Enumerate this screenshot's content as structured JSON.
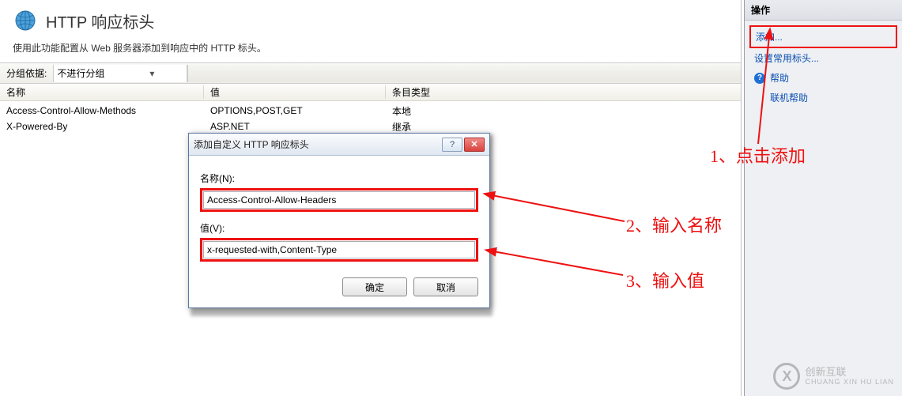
{
  "header": {
    "title": "HTTP 响应标头",
    "subtitle": "使用此功能配置从 Web 服务器添加到响应中的 HTTP 标头。"
  },
  "grouping": {
    "label": "分组依据:",
    "selected": "不进行分组"
  },
  "columns": {
    "name": "名称",
    "value": "值",
    "type": "条目类型"
  },
  "rows": [
    {
      "name": "Access-Control-Allow-Methods",
      "value": "OPTIONS,POST,GET",
      "type": "本地"
    },
    {
      "name": "X-Powered-By",
      "value": "ASP.NET",
      "type": "继承"
    }
  ],
  "actions": {
    "header": "操作",
    "add": "添加...",
    "set_common": "设置常用标头...",
    "help": "帮助",
    "online_help": "联机帮助"
  },
  "dialog": {
    "title": "添加自定义 HTTP 响应标头",
    "name_label": "名称(N):",
    "name_value": "Access-Control-Allow-Headers",
    "value_label": "值(V):",
    "value_value": "x-requested-with,Content-Type",
    "ok": "确定",
    "cancel": "取消"
  },
  "annotations": {
    "a1": "1、点击添加",
    "a2": "2、输入名称",
    "a3": "3、输入值"
  },
  "logo": {
    "brand": "创新互联",
    "sub": "CHUANG XIN HU LIAN"
  }
}
